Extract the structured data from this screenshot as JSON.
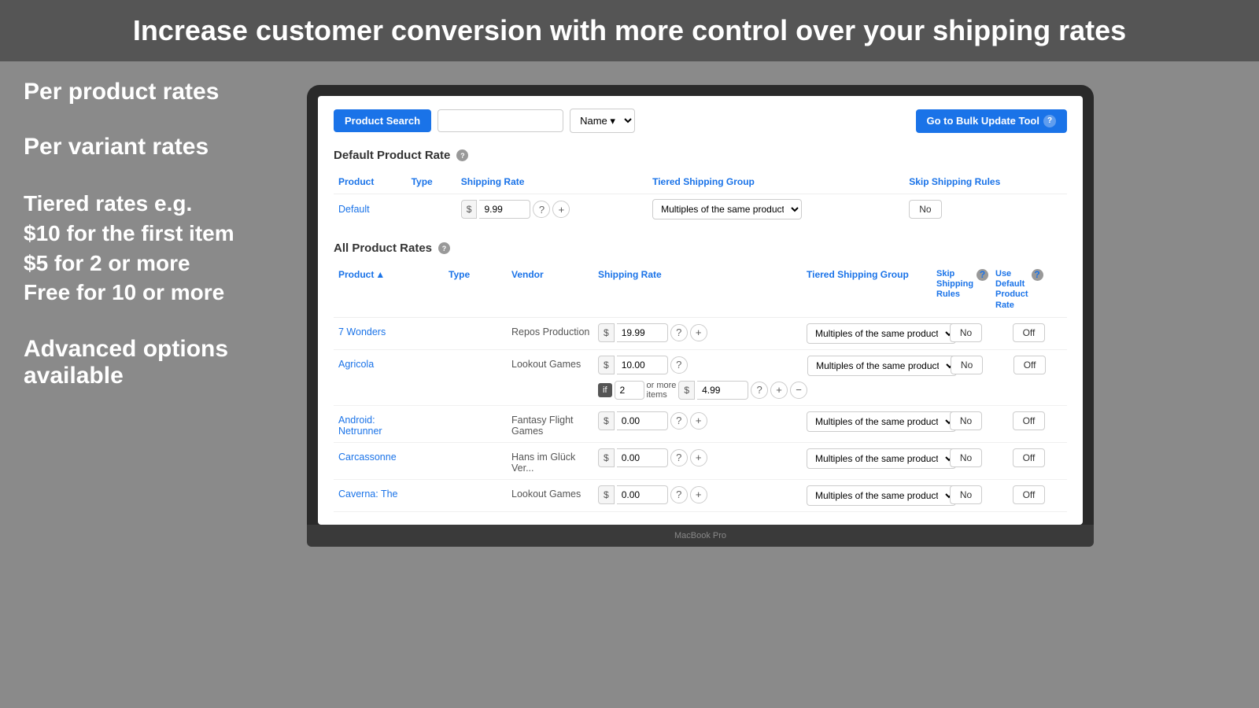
{
  "banner": {
    "title": "Increase customer conversion with more control over your shipping rates"
  },
  "left_features": [
    {
      "id": "f1",
      "text": "Per product rates"
    },
    {
      "id": "f2",
      "text": "Per variant rates"
    },
    {
      "id": "f3",
      "text": "Tiered rates e.g.\n$10 for the first item\n$5 for 2 or more\nFree for 10 or more"
    },
    {
      "id": "f4",
      "text": "Advanced options available"
    }
  ],
  "laptop_label": "MacBook Pro",
  "toolbar": {
    "product_search_label": "Product Search",
    "search_placeholder": "",
    "name_option": "Name ▾",
    "bulk_update_label": "Go to Bulk Update Tool"
  },
  "default_section": {
    "title": "Default Product Rate",
    "columns": {
      "product": "Product",
      "type": "Type",
      "shipping_rate": "Shipping Rate",
      "tiered_group": "Tiered Shipping Group",
      "skip_rules": "Skip Shipping Rules"
    },
    "row": {
      "product": "Default",
      "type": "",
      "rate": "9.99",
      "tiered_group": "Multiples of the same product",
      "skip": "No"
    }
  },
  "all_section": {
    "title": "All Product Rates",
    "columns": {
      "product": "Product",
      "type": "Type",
      "vendor": "Vendor",
      "shipping_rate": "Shipping Rate",
      "tiered_group": "Tiered Shipping Group",
      "skip_rules": "Skip Shipping Rules",
      "use_default": "Use Default Product Rate"
    },
    "rows": [
      {
        "id": "r1",
        "product": "7 Wonders",
        "type": "",
        "vendor": "Repos Production",
        "rates": [
          {
            "value": "19.99"
          }
        ],
        "tiered_group": "Multiples of the same product",
        "skip": "No",
        "use_default": "Off"
      },
      {
        "id": "r2",
        "product": "Agricola",
        "type": "",
        "vendor": "Lookout Games",
        "rates": [
          {
            "value": "10.00",
            "tier": false
          },
          {
            "value": "4.99",
            "tier": true,
            "qty": "2"
          }
        ],
        "tiered_group": "Multiples of the same product",
        "skip": "No",
        "use_default": "Off"
      },
      {
        "id": "r3",
        "product": "Android: Netrunner",
        "type": "",
        "vendor": "Fantasy Flight Games",
        "rates": [
          {
            "value": "0.00"
          }
        ],
        "tiered_group": "Multiples of the same product",
        "skip": "No",
        "use_default": "Off"
      },
      {
        "id": "r4",
        "product": "Carcassonne",
        "type": "",
        "vendor": "Hans im Glück Ver...",
        "rates": [
          {
            "value": "0.00"
          }
        ],
        "tiered_group": "Multiples of the same product",
        "skip": "No",
        "use_default": "Off"
      },
      {
        "id": "r5",
        "product": "Caverna: The",
        "type": "",
        "vendor": "Lookout Games",
        "rates": [
          {
            "value": "0.00"
          }
        ],
        "tiered_group": "Multiples of the same product",
        "skip": "No",
        "use_default": "Off"
      }
    ]
  }
}
